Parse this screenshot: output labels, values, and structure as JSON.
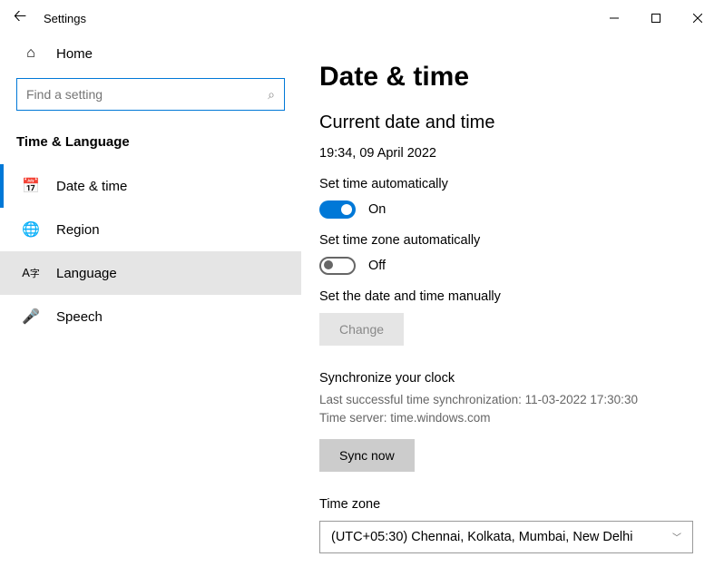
{
  "titlebar": {
    "title": "Settings"
  },
  "sidebar": {
    "home": "Home",
    "search_placeholder": "Find a setting",
    "section": "Time & Language",
    "items": [
      {
        "label": "Date & time"
      },
      {
        "label": "Region"
      },
      {
        "label": "Language"
      },
      {
        "label": "Speech"
      }
    ]
  },
  "main": {
    "h1": "Date & time",
    "h2": "Current date and time",
    "current_datetime": "19:34, 09 April 2022",
    "auto_time_label": "Set time automatically",
    "auto_time_state": "On",
    "auto_zone_label": "Set time zone automatically",
    "auto_zone_state": "Off",
    "manual_label": "Set the date and time manually",
    "change_btn": "Change",
    "sync_header": "Synchronize your clock",
    "sync_last": "Last successful time synchronization: 11-03-2022 17:30:30",
    "sync_server": "Time server: time.windows.com",
    "sync_btn": "Sync now",
    "tz_label": "Time zone",
    "tz_value": "(UTC+05:30) Chennai, Kolkata, Mumbai, New Delhi"
  }
}
